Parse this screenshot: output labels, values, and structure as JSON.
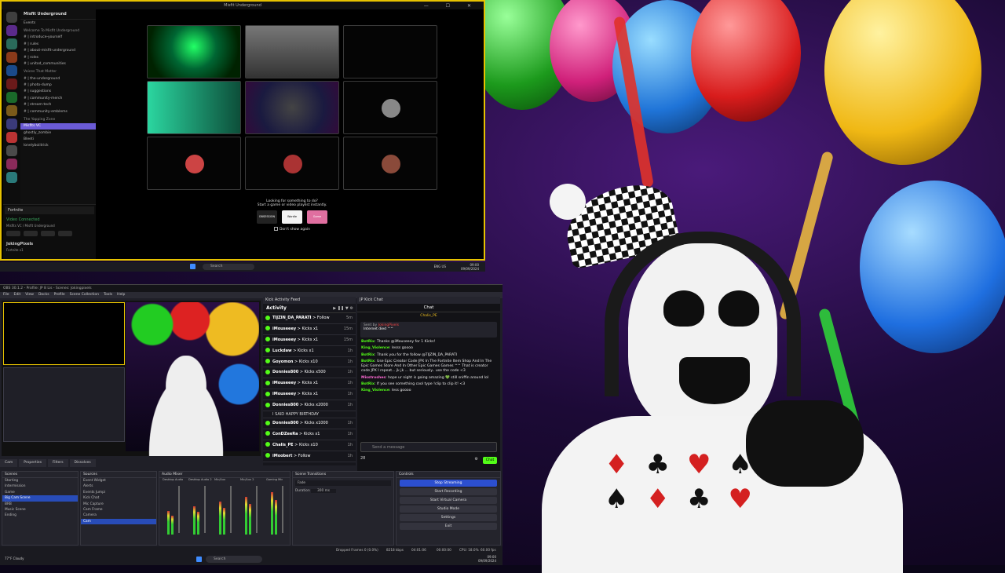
{
  "discord": {
    "window_title": "Misfit Underground",
    "window_buttons": "— ☐ ✕",
    "server_name": "Misfit Underground",
    "channels": [
      {
        "label": "Events",
        "type": "item"
      },
      {
        "label": "Welcome To Misfit Underground",
        "type": "cat"
      },
      {
        "label": "# | introduce-yourself",
        "type": "item"
      },
      {
        "label": "# | rules",
        "type": "item"
      },
      {
        "label": "# | about-misfit-underground",
        "type": "item"
      },
      {
        "label": "# | roles",
        "type": "item"
      },
      {
        "label": "# | unitod_communities",
        "type": "item"
      },
      {
        "label": "Voices That Matter",
        "type": "cat"
      },
      {
        "label": "# | the-underground",
        "type": "item"
      },
      {
        "label": "# | photo-dump",
        "type": "item"
      },
      {
        "label": "# | suggestions",
        "type": "item"
      },
      {
        "label": "# | community-merch",
        "type": "item"
      },
      {
        "label": "# | stream-tech",
        "type": "item"
      },
      {
        "label": "# | community-emblems",
        "type": "item"
      },
      {
        "label": "The Yapping Zone",
        "type": "cat"
      },
      {
        "label": "Misfits VC",
        "type": "active"
      },
      {
        "label": "ghostly_zombie",
        "type": "item"
      },
      {
        "label": "Bleeti",
        "type": "item"
      },
      {
        "label": "lonelyboiitrick",
        "type": "item"
      }
    ],
    "activity_game": "Fortnite",
    "voice_status": "Video Connected",
    "voice_sub": "Misfits VC / Misfit Underground",
    "username": "JokingPixels",
    "user_status": "Fortnite v1",
    "prompt_title": "Looking for something to do?",
    "prompt_sub": "Start a game or video playlist instantly.",
    "prompt_games": [
      "OBSESSION",
      "Wordle",
      "Game"
    ],
    "prompt_checkbox": "Don't show again"
  },
  "taskbar_top": {
    "search": "Search",
    "clock_time": "09:00",
    "clock_date": "09/09/2024",
    "lang": "ENG US"
  },
  "obs": {
    "title": "OBS 30.1.2 - Profile: JP 8 Lis - Scenes: Jokingpixels",
    "menu": [
      "File",
      "Edit",
      "View",
      "Docks",
      "Profile",
      "Scene Collection",
      "Tools",
      "Help"
    ],
    "dock_tabs": [
      "Cam",
      "Properties",
      "Filters",
      "Dissolves"
    ],
    "scenes_title": "Scenes",
    "scenes": [
      "Starting",
      "Intermission",
      "Game",
      "Big Cam Scene",
      "BRB",
      "Music Scene",
      "Ending"
    ],
    "scenes_selected": 3,
    "sources_title": "Sources",
    "sources": [
      "Event Widget",
      "Alerts",
      "Events Jumpi",
      "Kick Chat",
      "Mic Capture",
      "Cam Frame",
      "Camera",
      "Cam"
    ],
    "mixer_title": "Audio Mixer",
    "mixer_channels": [
      "Desktop Audio",
      "Desktop Audio 2",
      "Mic/Aux",
      "Mic/Aux 2",
      "Gaming Mic"
    ],
    "transitions_title": "Scene Transitions",
    "transition_value": "Fade",
    "duration_label": "Duration",
    "duration_value": "300 ms",
    "controls_title": "Controls",
    "controls": [
      "Stop Streaming",
      "Start Recording",
      "Start Virtual Camera",
      "Studio Mode",
      "Settings",
      "Exit"
    ],
    "status": {
      "dropped": "Dropped Frames 0 (0.0%)",
      "bitrate": "8218 kbps",
      "live": "04:01:06",
      "rec": "00:00:00",
      "cpu": "CPU: 18.0%",
      "fps": "60.00 fps"
    }
  },
  "activity_feed": {
    "panel_title": "Kick Activity Feed",
    "title": "Activity",
    "rows": [
      {
        "user": "TIJZIN_DA_PARATI",
        "action": "Follow",
        "time": "5m"
      },
      {
        "user": "iMouseeey",
        "action": "Kicks x1",
        "time": "15m"
      },
      {
        "user": "iMouseeey",
        "action": "Kicks x1",
        "time": "15m"
      },
      {
        "user": "Luckdaw",
        "action": "Kicks x1",
        "time": "1h"
      },
      {
        "user": "Goyomon",
        "action": "Kicks x10",
        "time": "1h"
      },
      {
        "user": "Donnies800",
        "action": "Kicks x500",
        "time": "1h"
      },
      {
        "user": "iMouseeey",
        "action": "Kicks x1",
        "time": "1h"
      },
      {
        "user": "iMouseeey",
        "action": "Kicks x1",
        "time": "1h"
      },
      {
        "user": "Donnies800",
        "action": "Kicks x2000",
        "time": "1h",
        "note": "I SAID HAPPY BIRTHDAY"
      },
      {
        "user": "Donnies800",
        "action": "Kicks x1000",
        "time": "1h"
      },
      {
        "user": "ConDZeeRa",
        "action": "Kicks x1",
        "time": "1h"
      },
      {
        "user": "Chalis_PE",
        "action": "Kicks x10",
        "time": "1h"
      },
      {
        "user": "iMoobert",
        "action": "Follow",
        "time": "1h"
      }
    ]
  },
  "chat": {
    "panel_title": "JP Kick Chat",
    "title": "Chat",
    "channel_user": "Chalis_PE",
    "pinned_by": "Sent by",
    "pinned_user": "JokingPixels",
    "pinned_text": "Internet died ^^",
    "messages": [
      {
        "user": "BotRix",
        "text": "Thanks @iMouseeey for 1 Kicks!"
      },
      {
        "user": "King_Violence",
        "text": "lesss goooo"
      },
      {
        "user": "BotRix",
        "text": "Thank you for the follow @TIJZIN_DA_PARATI"
      },
      {
        "user": "BotRix",
        "text": "Use Epic Creator Code JPX In The Fortnite Item Shop And In The Epic Games Store And In Other Epic Games Games ^^ That is creator code JPX I repeat... jk jk ... but seriously.. use the code <3"
      },
      {
        "user": "Misstroshes",
        "text": "hope ur night is going amazing 💚 still sniffin around lol"
      },
      {
        "user": "BotRix",
        "text": "If you see something cool type !clip to clip it! <3"
      },
      {
        "user": "King_Violence",
        "text": "less goooo"
      }
    ],
    "input_placeholder": "Send a message",
    "viewer_count": "28",
    "send_label": "Chat"
  },
  "taskbar_bottom": {
    "search": "Search",
    "clock_time": "09:00",
    "clock_date": "09/09/2024",
    "weather": "77°F Cloudy"
  },
  "colors": {
    "kick_green": "#53fc18",
    "discord_border": "#e7c200",
    "obs_blue": "#2c4fd0"
  }
}
